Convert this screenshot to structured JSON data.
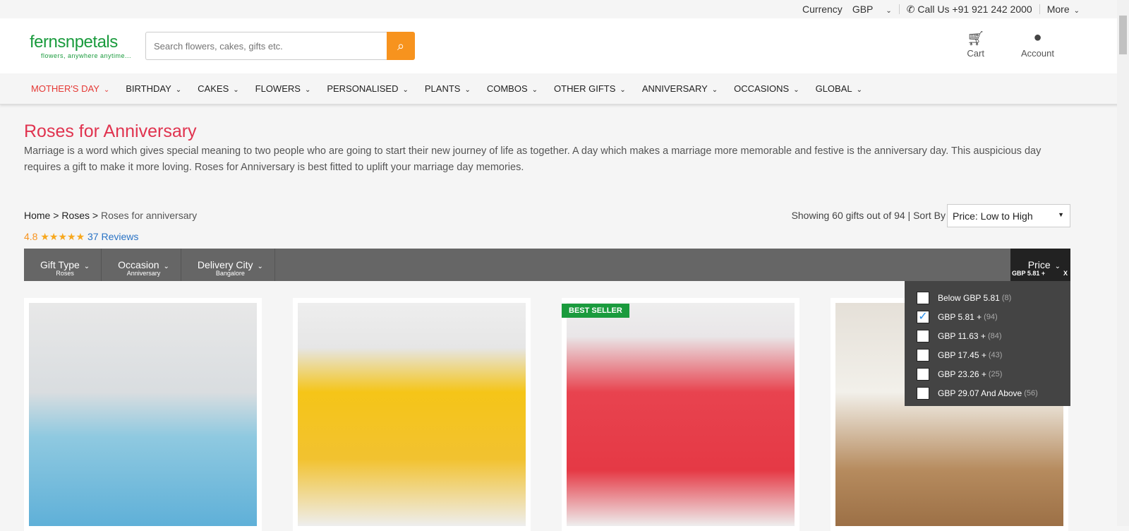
{
  "topbar": {
    "currency_label": "Currency",
    "currency": "GBP",
    "call": "Call Us +91 921 242 2000",
    "more": "More"
  },
  "header": {
    "logo_name": "fernsnpetals",
    "logo_tagline": "flowers, anywhere anytime...",
    "search_placeholder": "Search flowers, cakes, gifts etc.",
    "cart": "Cart",
    "account": "Account"
  },
  "nav": [
    "MOTHER'S DAY",
    "BIRTHDAY",
    "CAKES",
    "FLOWERS",
    "PERSONALISED",
    "PLANTS",
    "COMBOS",
    "OTHER GIFTS",
    "ANNIVERSARY",
    "OCCASIONS",
    "GLOBAL"
  ],
  "page": {
    "title": "Roses for Anniversary",
    "description": "Marriage is a word which gives special meaning to two people who are going to start their new journey of life as together. A day which makes a marriage more memorable and festive is the anniversary day. This auspicious day requires a gift to make it more loving. Roses for Anniversary is best fitted to uplift your marriage day memories."
  },
  "breadcrumb": [
    "Home",
    "Roses",
    "Roses for anniversary"
  ],
  "rating": {
    "value": "4.8",
    "stars": "★★★★★",
    "reviews": "37  Reviews"
  },
  "results": {
    "showing": "Showing 60 gifts out of 94 |  Sort By",
    "sort": "Price: Low to High"
  },
  "filters": [
    {
      "title": "Gift Type",
      "value": "Roses"
    },
    {
      "title": "Occasion",
      "value": "Anniversary"
    },
    {
      "title": "Delivery City",
      "value": "Bangalore"
    }
  ],
  "price_filter": {
    "title": "Price",
    "selected": "GBP  5.81 +",
    "clear": "X",
    "options": [
      {
        "label": "Below GBP  5.81",
        "count": "(8)",
        "checked": false
      },
      {
        "label": "GBP  5.81 +",
        "count": "(94)",
        "checked": true
      },
      {
        "label": "GBP  11.63 +",
        "count": "(84)",
        "checked": false
      },
      {
        "label": "GBP  17.45 +",
        "count": "(43)",
        "checked": false
      },
      {
        "label": "GBP  23.26 +",
        "count": "(25)",
        "checked": false
      },
      {
        "label": "GBP  29.07 And Above",
        "count": "(56)",
        "checked": false
      }
    ]
  },
  "products": [
    {
      "badge": ""
    },
    {
      "badge": ""
    },
    {
      "badge": "BEST SELLER"
    },
    {
      "badge": ""
    }
  ]
}
